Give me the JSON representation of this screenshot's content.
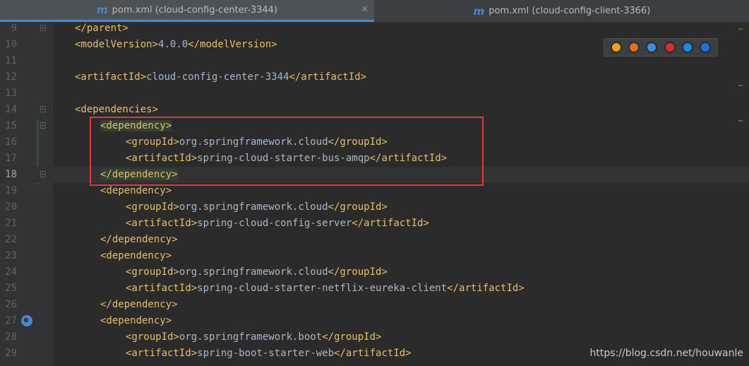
{
  "tabs": [
    {
      "label": "pom.xml (cloud-config-center-3344)",
      "icon": "maven-m-icon"
    },
    {
      "label": "pom.xml (cloud-config-client-3366)",
      "icon": "maven-m-icon"
    }
  ],
  "tab_close": "✕",
  "tab_icon_glyph": "m",
  "lines": [
    {
      "num": "9",
      "text": "</parent>",
      "indent": 0
    },
    {
      "num": "10",
      "text": "<modelVersion>4.0.0</modelVersion>",
      "indent": 0
    },
    {
      "num": "11",
      "text": "",
      "indent": 0
    },
    {
      "num": "12",
      "text": "<artifactId>cloud-config-center-3344</artifactId>",
      "indent": 0
    },
    {
      "num": "13",
      "text": "",
      "indent": 0
    },
    {
      "num": "14",
      "text": "<dependencies>",
      "indent": 0
    },
    {
      "num": "15",
      "text": "<dependency>",
      "indent": 1,
      "highlight": true
    },
    {
      "num": "16",
      "text": "<groupId>org.springframework.cloud</groupId>",
      "indent": 2
    },
    {
      "num": "17",
      "text": "<artifactId>spring-cloud-starter-bus-amqp</artifactId>",
      "indent": 2
    },
    {
      "num": "18",
      "text": "</dependency>",
      "indent": 1,
      "highlight": true,
      "current": true
    },
    {
      "num": "19",
      "text": "<dependency>",
      "indent": 1
    },
    {
      "num": "20",
      "text": "<groupId>org.springframework.cloud</groupId>",
      "indent": 2
    },
    {
      "num": "21",
      "text": "<artifactId>spring-cloud-config-server</artifactId>",
      "indent": 2
    },
    {
      "num": "22",
      "text": "</dependency>",
      "indent": 1
    },
    {
      "num": "23",
      "text": "<dependency>",
      "indent": 1
    },
    {
      "num": "24",
      "text": "<groupId>org.springframework.cloud</groupId>",
      "indent": 2
    },
    {
      "num": "25",
      "text": "<artifactId>spring-cloud-starter-netflix-eureka-client</artifactId>",
      "indent": 2
    },
    {
      "num": "26",
      "text": "</dependency>",
      "indent": 1
    },
    {
      "num": "27",
      "text": "<dependency>",
      "indent": 1
    },
    {
      "num": "28",
      "text": "<groupId>org.springframework.boot</groupId>",
      "indent": 2
    },
    {
      "num": "29",
      "text": "<artifactId>spring-boot-starter-web</artifactId>",
      "indent": 2
    }
  ],
  "browsers": [
    {
      "name": "chrome-icon",
      "color": "#e9a21a"
    },
    {
      "name": "firefox-icon",
      "color": "#e66a1f"
    },
    {
      "name": "safari-icon",
      "color": "#3b8fd9"
    },
    {
      "name": "opera-icon",
      "color": "#d32f2f"
    },
    {
      "name": "ie-icon",
      "color": "#1e88e5"
    },
    {
      "name": "edge-icon",
      "color": "#1976d2"
    }
  ],
  "watermark": "https://blog.csdn.net/houwanle",
  "colors": {
    "tag": "#e8bf6a",
    "text": "#a9b7c6",
    "highlight": "#344134",
    "annotation_box": "#e53935",
    "accent": "#4a88c7"
  }
}
